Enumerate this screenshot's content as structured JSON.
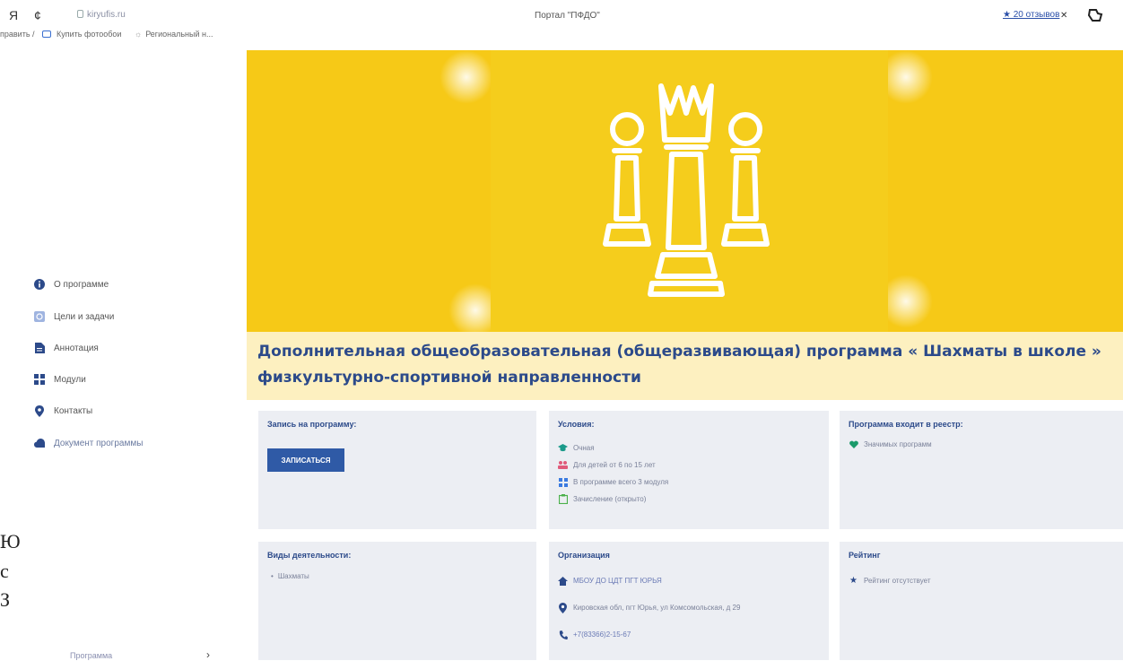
{
  "browser": {
    "back_label": "Я",
    "refresh_label": "¢",
    "url": "kiryufis.ru",
    "page_title": "Портал \"ПФДО\"",
    "reviews_label": "★ 20 отзывов",
    "bookmarks": [
      "править /",
      "Купить фотообои",
      "Региональный н..."
    ]
  },
  "sidebar": {
    "items": [
      {
        "label": "О программе",
        "icon": "info-icon"
      },
      {
        "label": "Цели и задачи",
        "icon": "target-icon"
      },
      {
        "label": "Аннотация",
        "icon": "document-icon"
      },
      {
        "label": "Модули",
        "icon": "grid-icon"
      },
      {
        "label": "Контакты",
        "icon": "location-pin-icon"
      },
      {
        "label": "Документ программы",
        "icon": "cloud-icon"
      }
    ],
    "bottom_label": "Программа",
    "partial_text": [
      "Ю",
      "с",
      "З"
    ]
  },
  "banner": {
    "icon": "chess-pieces-icon",
    "colors": {
      "background": "#f6c917",
      "figure": "#ffffff"
    }
  },
  "program": {
    "title": "Дополнительная общеобразовательная (общеразвивающая) программа « Шахматы в школе » физкультурно-спортивной направленности"
  },
  "cards": {
    "enroll": {
      "title": "Запись на программу:",
      "button": "ЗАПИСАТЬСЯ"
    },
    "conditions": {
      "title": "Условия:",
      "items": [
        {
          "text": "Очная",
          "icon": "graduation-cap-icon"
        },
        {
          "text": "Для детей от 6 по 15 лет",
          "icon": "people-icon"
        },
        {
          "text": "В программе всего 3 модуля",
          "icon": "modules-grid-icon"
        },
        {
          "text": "Зачисление (открыто)",
          "icon": "clipboard-icon"
        }
      ]
    },
    "registry": {
      "title": "Программа входит в реестр:",
      "items": [
        {
          "text": "Значимых программ",
          "icon": "heart-icon"
        }
      ]
    },
    "activities": {
      "title": "Виды деятельности:",
      "items": [
        "Шахматы"
      ]
    },
    "organization": {
      "title": "Организация",
      "name": "МБОУ ДО ЦДТ ПГТ ЮРЬЯ",
      "address": "Кировская обл, пгт Юрья, ул Комсомольская, д 29",
      "phone": "+7(83366)2-15-67"
    },
    "rating": {
      "title": "Рейтинг",
      "text": "Рейтинг отсутствует"
    }
  },
  "colors": {
    "accent": "#2c4a8a",
    "button": "#2f5aa6",
    "card_bg": "#eceef3",
    "title_strip": "#fdf0c0"
  }
}
